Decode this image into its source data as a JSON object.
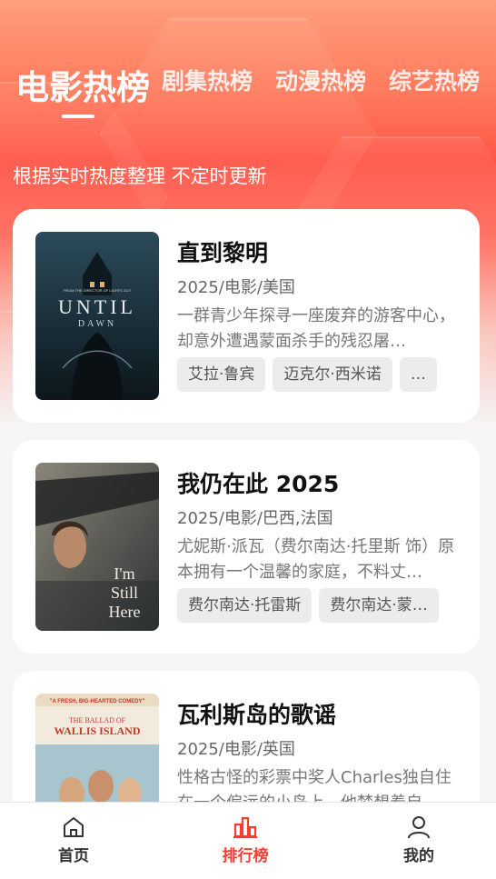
{
  "tabs": [
    {
      "label": "电影热榜",
      "active": true
    },
    {
      "label": "剧集热榜",
      "active": false
    },
    {
      "label": "动漫热榜",
      "active": false
    },
    {
      "label": "综艺热榜",
      "active": false
    }
  ],
  "subtitle": "根据实时热度整理 不定时更新",
  "movies": [
    {
      "title": "直到黎明",
      "meta": "2025/电影/美国",
      "desc": "一群青少年探寻一座废弃的游客中心，却意外遭遇蒙面杀手的残忍屠…",
      "cast": [
        "艾拉·鲁宾",
        "迈克尔·西米诺",
        "…"
      ],
      "poster": {
        "top_text": "FROM THE DIRECTOR OF LIGHTS OUT",
        "line1": "UNTIL",
        "line2": "DAWN",
        "colors": [
          "#1f3b4a",
          "#0d1a22"
        ]
      }
    },
    {
      "title": "我仍在此 2025",
      "meta": "2025/电影/巴西,法国",
      "desc": "尤妮斯·派瓦（费尔南达·托里斯 饰）原本拥有一个温馨的家庭，不料丈…",
      "cast": [
        "费尔南达·托雷斯",
        "费尔南达·蒙…"
      ],
      "poster": {
        "line1": "I'm",
        "line2": "Still",
        "line3": "Here",
        "colors": [
          "#6b6a66",
          "#3a3c3d"
        ]
      }
    },
    {
      "title": "瓦利斯岛的歌谣",
      "meta": "2025/电影/英国",
      "desc": "性格古怪的彩票中奖人Charles独自住在一个偏远的小岛上，他梦想着自…",
      "cast": [],
      "poster": {
        "quote": "\"A FRESH, BIG-HEARTED COMEDY\"",
        "line1": "THE BALLAD OF",
        "line2": "WALLIS ISLAND",
        "colors": [
          "#f3ede0",
          "#d9cbb0"
        ]
      }
    }
  ],
  "nav": [
    {
      "label": "首页",
      "icon": "home-icon",
      "active": false
    },
    {
      "label": "排行榜",
      "icon": "chart-bar-icon",
      "active": true
    },
    {
      "label": "我的",
      "icon": "user-icon",
      "active": false
    }
  ],
  "colors": {
    "accent": "#ff3b30",
    "header_top": "#ff9f7d",
    "header_mid": "#ff5546"
  }
}
